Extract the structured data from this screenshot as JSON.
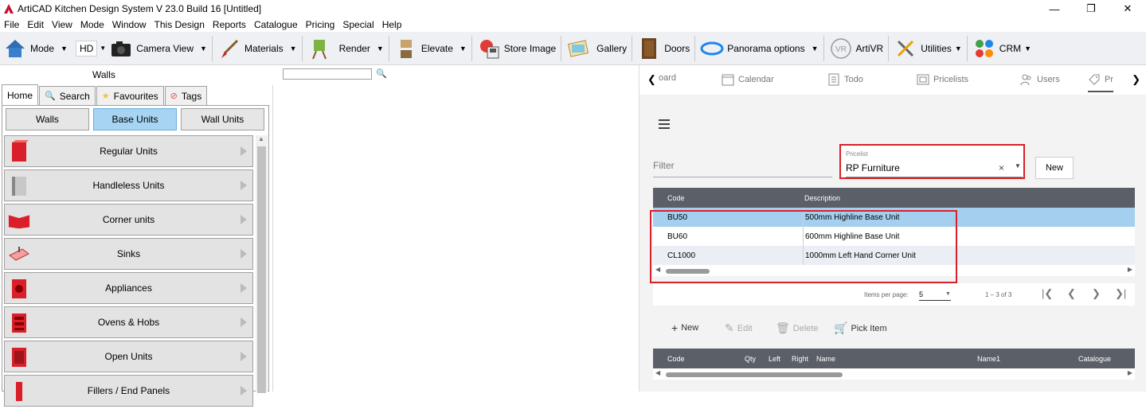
{
  "window": {
    "title": "ArtiCAD Kitchen Design System  V 23.0 Build 16  [Untitled]",
    "minimize": "—",
    "maximize": "❐",
    "close": "✕"
  },
  "menu": [
    "File",
    "Edit",
    "View",
    "Mode",
    "Window",
    "This Design",
    "Reports",
    "Catalogue",
    "Pricing",
    "Special",
    "Help"
  ],
  "toolbar": {
    "mode": "Mode",
    "hd": "HD",
    "camera": "Camera View",
    "materials": "Materials",
    "render": "Render",
    "elevate": "Elevate",
    "store_image": "Store Image",
    "gallery": "Gallery",
    "doors": "Doors",
    "panorama": "Panorama options",
    "artivr": "ArtiVR",
    "utilities": "Utilities",
    "crm": "CRM"
  },
  "left": {
    "walls_label": "Walls",
    "tabs": [
      "Home",
      "Search",
      "Favourites",
      "Tags"
    ],
    "categories": [
      "Walls",
      "Base Units",
      "Wall Units"
    ],
    "units": [
      "Regular Units",
      "Handleless Units",
      "Corner units",
      "Sinks",
      "Appliances",
      "Ovens & Hobs",
      "Open Units",
      "Fillers / End Panels"
    ]
  },
  "right": {
    "tabs": [
      "oard",
      "Calendar",
      "Todo",
      "Pricelists",
      "Users",
      "Pr"
    ],
    "filter_placeholder": "Filter",
    "pricelist_label": "Pricelist",
    "pricelist_value": "RP Furniture",
    "clear": "×",
    "new_label": "New",
    "grid_headers": [
      "Code",
      "Description"
    ],
    "rows": [
      {
        "code": "BU50",
        "description": "500mm Highline Base Unit"
      },
      {
        "code": "BU60",
        "description": "600mm Highline Base Unit"
      },
      {
        "code": "CL1000",
        "description": "1000mm Left Hand Corner Unit"
      }
    ],
    "pager": {
      "items_per_page_label": "Items per page:",
      "page_size": "5",
      "range": "1 – 3 of 3"
    },
    "actions": {
      "new": "New",
      "edit": "Edit",
      "delete": "Delete",
      "pick": "Pick Item"
    },
    "bottom_headers": [
      "Code",
      "Qty",
      "Left",
      "Right",
      "Name",
      "Name1",
      "Catalogue"
    ]
  },
  "colors": {
    "accent_selection": "#a5cfee",
    "highlight": "#d9202a",
    "grid_header": "#5b6068"
  }
}
